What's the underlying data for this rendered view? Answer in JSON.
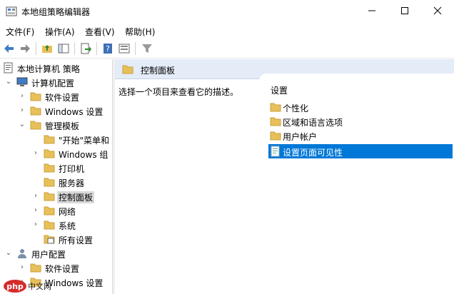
{
  "window": {
    "title": "本地组策略编辑器"
  },
  "menu": [
    "文件(F)",
    "操作(A)",
    "查看(V)",
    "帮助(H)"
  ],
  "tree": [
    {
      "label": "本地计算机 策略",
      "icon": "computer-policy-icon",
      "twisty": ""
    },
    {
      "label": "计算机配置",
      "icon": "computer-icon",
      "twisty": "expanded"
    },
    {
      "label": "软件设置",
      "icon": "folder-icon",
      "twisty": "collapsed"
    },
    {
      "label": "Windows 设置",
      "icon": "folder-icon",
      "twisty": "collapsed"
    },
    {
      "label": "管理模板",
      "icon": "folder-icon",
      "twisty": "expanded"
    },
    {
      "label": "\"开始\"菜单和",
      "icon": "folder-icon",
      "twisty": ""
    },
    {
      "label": "Windows 组",
      "icon": "folder-icon",
      "twisty": "collapsed"
    },
    {
      "label": "打印机",
      "icon": "folder-icon",
      "twisty": ""
    },
    {
      "label": "服务器",
      "icon": "folder-icon",
      "twisty": ""
    },
    {
      "label": "控制面板",
      "icon": "folder-icon",
      "twisty": "collapsed"
    },
    {
      "label": "网络",
      "icon": "folder-icon",
      "twisty": "collapsed"
    },
    {
      "label": "系统",
      "icon": "folder-icon",
      "twisty": "collapsed"
    },
    {
      "label": "所有设置",
      "icon": "all-settings-icon",
      "twisty": ""
    },
    {
      "label": "用户配置",
      "icon": "user-icon",
      "twisty": "expanded"
    },
    {
      "label": "软件设置",
      "icon": "folder-icon",
      "twisty": "collapsed"
    },
    {
      "label": "Windows 设置",
      "icon": "folder-icon",
      "twisty": "collapsed"
    }
  ],
  "right_pane": {
    "header": "控制面板",
    "description": "选择一个项目来查看它的描述。",
    "column": "设置",
    "items": [
      {
        "label": "个性化",
        "icon": "folder-icon"
      },
      {
        "label": "区域和语言选项",
        "icon": "folder-icon"
      },
      {
        "label": "用户帐户",
        "icon": "folder-icon"
      },
      {
        "label": "设置页面可见性",
        "icon": "setting-icon"
      }
    ]
  },
  "watermark": "php中文网",
  "colors": {
    "selection": "#0078d7",
    "header_bg": "#e3ecf7",
    "folder": "#e8c05a"
  }
}
